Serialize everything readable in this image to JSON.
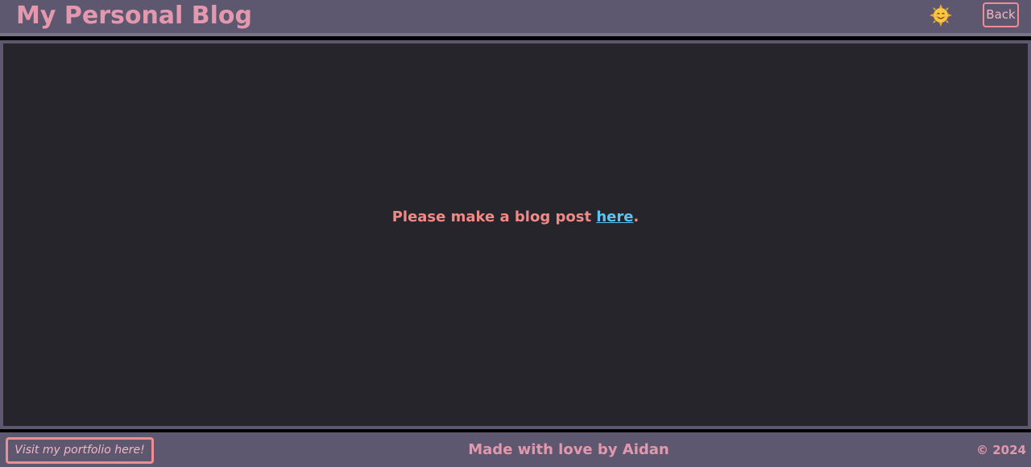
{
  "header": {
    "title": "My Personal Blog",
    "theme_icon": "sun-face-icon",
    "back_label": "Back"
  },
  "main": {
    "message_prefix": "Please make a blog post ",
    "link_label": "here",
    "message_suffix": "."
  },
  "footer": {
    "portfolio_label": "Visit my portfolio here!",
    "credit": "Made with love by Aidan",
    "copyright": "© 2024"
  },
  "colors": {
    "bar_background": "#5d5870",
    "content_background": "#27252c",
    "accent_pink": "#e498ad",
    "accent_salmon": "#f18a86",
    "link_blue": "#5cc4f4",
    "button_border": "#ee8d96"
  }
}
